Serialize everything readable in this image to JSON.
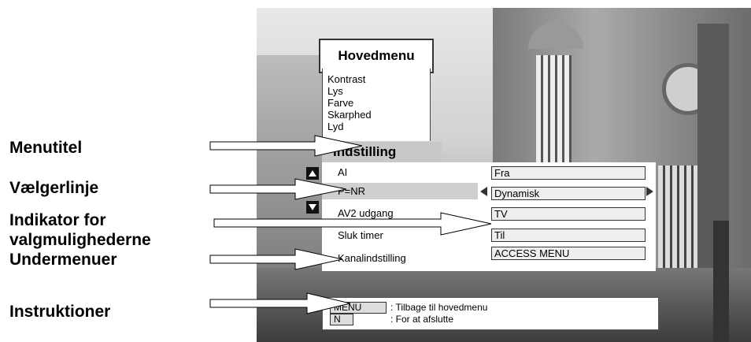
{
  "callouts": {
    "menutitel": "Menutitel",
    "vaelgerlinje": "Vælgerlinje",
    "indikator_line1": "Indikator for",
    "indikator_line2": "valgmulighederne",
    "undermenuer": "Undermenuer",
    "instruktioner": "Instruktioner"
  },
  "main_menu": {
    "title": "Hovedmenu",
    "items": [
      "Kontrast",
      "Lys",
      "Farve",
      "Skarphed",
      "Lyd"
    ]
  },
  "submenu": {
    "title": "Indstilling",
    "rows": [
      {
        "label": "AI",
        "value": "Fra"
      },
      {
        "label": "P=NR",
        "value": "Dynamisk"
      },
      {
        "label": "AV2 udgang",
        "value": "TV"
      },
      {
        "label": "Sluk timer",
        "value": "Til"
      },
      {
        "label": "Kanalindstilling",
        "value": "ACCESS MENU"
      }
    ],
    "selected_row": 1
  },
  "instructions": {
    "menu_key": "MENU",
    "menu_text": ": Tilbage til hovedmenu",
    "n_key": "N",
    "n_text": ": For at afslutte"
  }
}
